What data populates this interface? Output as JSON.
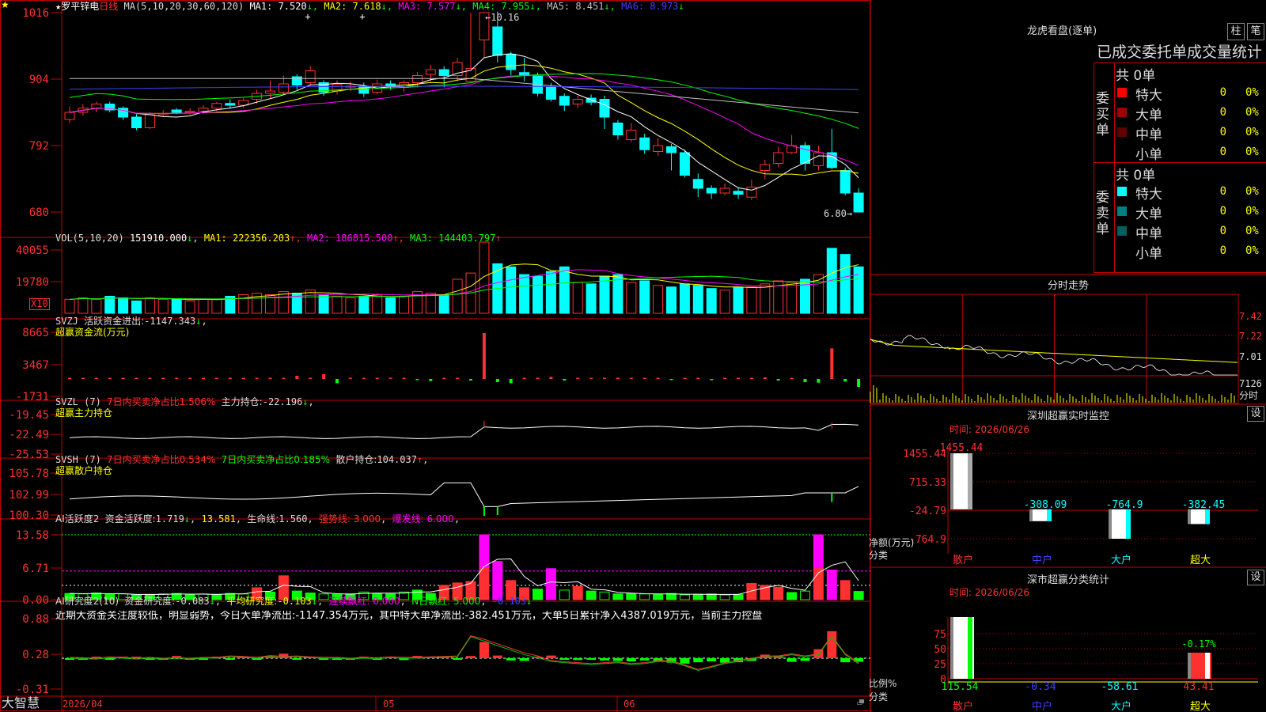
{
  "app": {
    "brand": "大智慧"
  },
  "chart": {
    "stock": "罗平锌电",
    "period": "日线",
    "ma_title": "MA(5,10,20,30,60,120)",
    "ma_items": [
      {
        "label": "MA1:",
        "value": "7.520",
        "arrow": "↓",
        "color": "#ffffff"
      },
      {
        "label": "MA2:",
        "value": "7.618",
        "arrow": "↓",
        "color": "#ffff00"
      },
      {
        "label": "MA3:",
        "value": "7.577",
        "arrow": "↓",
        "color": "#ff00ff"
      },
      {
        "label": "MA4:",
        "value": "7.955",
        "arrow": "↓",
        "color": "#00ff00"
      },
      {
        "label": "MA5:",
        "value": "8.451",
        "arrow": "↓",
        "color": "#c0c0c0"
      },
      {
        "label": "MA6:",
        "value": "8.973",
        "arrow": "↓",
        "color": "#4040ff"
      }
    ],
    "y_ticks": [
      "1016",
      "904",
      "792",
      "680"
    ],
    "high_label": "10.16",
    "low_label": "6.80"
  },
  "vol": {
    "title": "VOL(5,10,20)",
    "value": "151910.000",
    "items": [
      {
        "label": "MA1:",
        "value": "222356.203",
        "arrow": "↑",
        "color": "#ffff00"
      },
      {
        "label": "MA2:",
        "value": "186815.500",
        "arrow": "↑",
        "color": "#ff00ff"
      },
      {
        "label": "MA3:",
        "value": "144403.797",
        "arrow": "↑",
        "color": "#00ff00"
      }
    ],
    "y_ticks": [
      "40055",
      "19780"
    ],
    "unit": "X10"
  },
  "svzj": {
    "title": "SVZJ",
    "label": "活跃资金进出:",
    "value": "-1147.343",
    "arrow": "↓",
    "sub": "超赢资金流(万元)",
    "y_ticks": [
      "8665",
      "3467",
      "-1731"
    ]
  },
  "svzl": {
    "title": "SVZL (7)",
    "ratio_text": "7日内买卖净占比1.506%",
    "label": "主力持仓:",
    "value": "-22.196",
    "arrow": "↓",
    "sub": "超赢主力持仓",
    "y_ticks": [
      "-19.45",
      "-22.49",
      "-25.53"
    ]
  },
  "svsh": {
    "title": "SVSH (7)",
    "ratio_text1": "7日内买卖净占比0.534%",
    "ratio_text2": "7日内买卖净占比0.185%",
    "label": "散户持仓:",
    "value": "104.037",
    "arrow": "↑",
    "sub": "超赢散户持仓",
    "y_ticks": [
      "105.78",
      "102.99",
      "100.30"
    ]
  },
  "ai1": {
    "title": "AI活跃度2",
    "label": "资金活跃度:",
    "value": "1.719",
    "arrow": "↓",
    "v2": "13.581",
    "life_label": "生命线:",
    "life": "1.560",
    "strong": "强势线: 3.000",
    "burst": "爆发线: 6.000",
    "y_ticks": [
      "13.58",
      "6.71",
      "0.00"
    ]
  },
  "ai2": {
    "title": "AI研究度2(10)",
    "label": "资金研究度:",
    "value": "-0.083",
    "avg_label": "平均研究度:",
    "avg": "-0.103",
    "red": "连续飘红: 0.000",
    "nred": "N日飘红: 5.000",
    "last": "-0.103",
    "y_ticks": [
      "0.88",
      "0.28",
      "-0.31"
    ],
    "commentary": "近期大资金关注度较低，明显弱势，今日大单净流出:-1147.354万元，其中特大单净流出:-382.451万元，大单5日累计净入4387.019万元，当前主力控盘"
  },
  "xaxis": {
    "labels": [
      "2026/04",
      "05",
      "06"
    ]
  },
  "dragon": {
    "title": "龙虎看盘(逐单)",
    "btn1": "柱",
    "btn2": "笔",
    "header": "已成交委托单成交量统计",
    "buy": {
      "side": [
        "委",
        "买",
        "单"
      ],
      "total": "共 0单",
      "rows": [
        {
          "name": "特大",
          "count": "0",
          "pct": "0%",
          "color": "#ff0000"
        },
        {
          "name": "大单",
          "count": "0",
          "pct": "0%",
          "color": "#a00000"
        },
        {
          "name": "中单",
          "count": "0",
          "pct": "0%",
          "color": "#600000"
        },
        {
          "name": "小单",
          "count": "0",
          "pct": "0%",
          "color": "#000000"
        }
      ]
    },
    "sell": {
      "side": [
        "委",
        "卖",
        "单"
      ],
      "total": "共 0单",
      "rows": [
        {
          "name": "特大",
          "count": "0",
          "pct": "0%",
          "color": "#00ffff"
        },
        {
          "name": "大单",
          "count": "0",
          "pct": "0%",
          "color": "#008080"
        },
        {
          "name": "中单",
          "count": "0",
          "pct": "0%",
          "color": "#006060"
        },
        {
          "name": "小单",
          "count": "0",
          "pct": "0%",
          "color": "#000000"
        }
      ]
    }
  },
  "intraday": {
    "title": "分时走势",
    "y_ticks": [
      "7.42",
      "7.22",
      "7.01"
    ],
    "vol_label": "7126",
    "vol_unit": "分时"
  },
  "monitor": {
    "title": "深圳超赢实时监控",
    "btn": "设",
    "time": "时间: 2026/06/26",
    "y_ticks": [
      "1455.44",
      "715.33",
      "-24.79",
      "-764.9"
    ],
    "y_label": "净额(万元)",
    "x_label": "分类",
    "chart_data": {
      "type": "bar",
      "categories": [
        "散户",
        "中户",
        "大户",
        "超大"
      ],
      "values": [
        1455.44,
        -308.09,
        -764.9,
        -382.45
      ],
      "ylabel": "净额(万元)"
    },
    "value_labels": [
      "1455.44",
      "-308.09",
      "-764.9",
      "-382.45"
    ]
  },
  "classify": {
    "title": "深市超赢分类统计",
    "btn": "设",
    "time": "时间: 2026/06/26",
    "y_ticks": [
      "75",
      "50",
      "25",
      "0"
    ],
    "y_label": "比例%",
    "x_label": "分类",
    "chart_data": {
      "type": "bar",
      "categories": [
        "散户",
        "中户",
        "大户",
        "超大"
      ],
      "values": [
        115.54,
        -0.34,
        -58.61,
        43.41
      ],
      "ylabel": "比例%"
    },
    "value_labels": [
      "115.54",
      "-0.34",
      "-58.61",
      "43.41"
    ],
    "top_label": "-0.17%"
  }
}
